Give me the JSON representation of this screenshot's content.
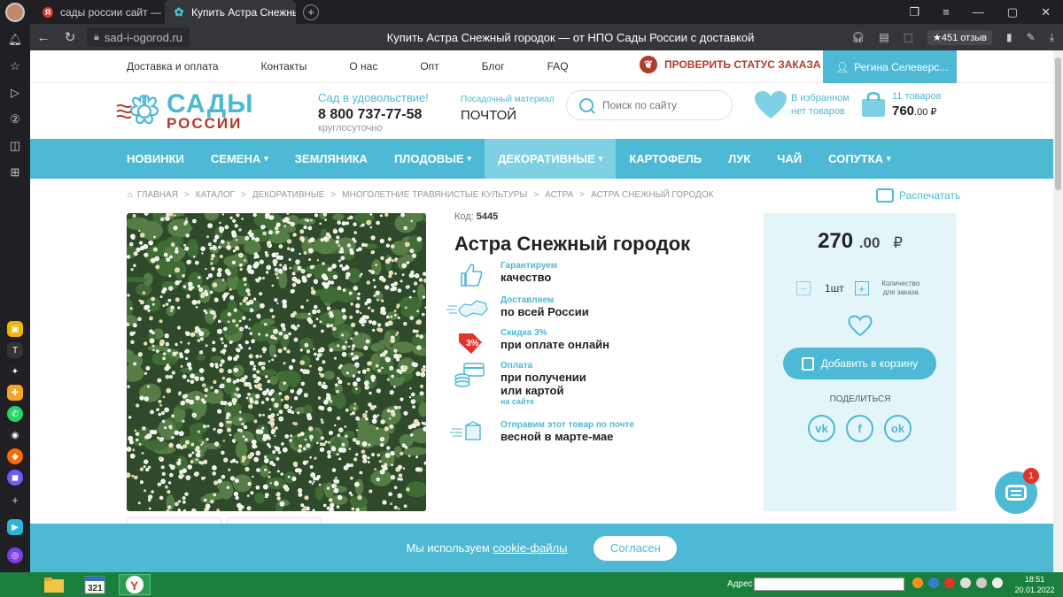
{
  "browser": {
    "tabs": [
      {
        "label": "сады россии сайт — Яндекс",
        "active": false
      },
      {
        "label": "Купить Астра Снежный гор",
        "active": true
      }
    ],
    "url": "sad-i-ogorod.ru",
    "page_title": "Купить Астра Снежный городок — от НПО Сады России с доставкой",
    "reviews": "★451 отзыв"
  },
  "topnav": {
    "links": [
      "Доставка и оплата",
      "Контакты",
      "О нас",
      "Опт",
      "Блог",
      "FAQ"
    ],
    "status_btn": "ПРОВЕРИТЬ СТАТУС ЗАКАЗА",
    "user": "Регина Селеверс..."
  },
  "header": {
    "logo_top": "САДЫ",
    "logo_bottom": "РОССИИ",
    "slogan": "Сад в удовольствие!",
    "phone": "8 800 737-77-58",
    "hours": "круглосуточно",
    "postal_label": "Посадочный материал",
    "postal_value": "ПОЧТОЙ",
    "search_placeholder": "Поиск по сайту",
    "fav_line1": "В избранном",
    "fav_line2": "нет товаров",
    "cart_count": "11 товаров",
    "cart_total": "760",
    "cart_kop": ".00 ₽"
  },
  "mainnav": [
    {
      "label": "НОВИНКИ",
      "dropdown": false,
      "active": false
    },
    {
      "label": "СЕМЕНА",
      "dropdown": true,
      "active": false
    },
    {
      "label": "ЗЕМЛЯНИКА",
      "dropdown": false,
      "active": false
    },
    {
      "label": "ПЛОДОВЫЕ",
      "dropdown": true,
      "active": false
    },
    {
      "label": "ДЕКОРАТИВНЫЕ",
      "dropdown": true,
      "active": true
    },
    {
      "label": "КАРТОФЕЛЬ",
      "dropdown": false,
      "active": false
    },
    {
      "label": "ЛУК",
      "dropdown": false,
      "active": false
    },
    {
      "label": "ЧАЙ",
      "dropdown": false,
      "active": false
    },
    {
      "label": "СОПУТКА",
      "dropdown": true,
      "active": false
    }
  ],
  "breadcrumbs": [
    "ГЛАВНАЯ",
    "КАТАЛОГ",
    "ДЕКОРАТИВНЫЕ",
    "МНОГОЛЕТНИЕ ТРАВЯНИСТЫЕ КУЛЬТУРЫ",
    "АСТРА",
    "АСТРА СНЕЖНЫЙ ГОРОДОК"
  ],
  "print_label": "Распечатать",
  "product": {
    "code_label": "Код:",
    "code": "5445",
    "title": "Астра Снежный городок",
    "features": [
      {
        "icon": "thumb-up-icon",
        "l1": "Гарантируем",
        "l2": "качество",
        "l3": ""
      },
      {
        "icon": "russia-map-icon",
        "l1": "Доставляем",
        "l2": "по всей России",
        "l3": ""
      },
      {
        "icon": "discount-tag-icon",
        "l1": "Скидка 3%",
        "l2": "при оплате онлайн",
        "l3": ""
      },
      {
        "icon": "card-coins-icon",
        "l1": "Оплата",
        "l2": "при получении\nили картой",
        "l3": "на сайте"
      },
      {
        "icon": "shipping-box-icon",
        "l1": "Отправим этот товар по почте",
        "l2": "весной в марте-мае",
        "l3": ""
      }
    ],
    "discount_badge": "3%"
  },
  "buybox": {
    "price": "270",
    "kop": ".00",
    "currency": "₽",
    "qty": "1шт",
    "qty_label": "Количество для заказа",
    "add_to_cart": "Добавить в корзину",
    "share": "ПОДЕЛИТЬСЯ",
    "socials": [
      "vk",
      "f",
      "ok"
    ]
  },
  "chat_badge": "1",
  "cookie": {
    "text": "Мы используем ",
    "link": "cookie-файлы",
    "agree": "Согласен"
  },
  "taskbar": {
    "address_label": "Адрес",
    "time": "18:51",
    "date": "20.01.2022"
  },
  "colors": {
    "brand_blue": "#4db9d4",
    "brand_red": "#b33a2a",
    "taskbar_green": "#1a7f3c"
  }
}
